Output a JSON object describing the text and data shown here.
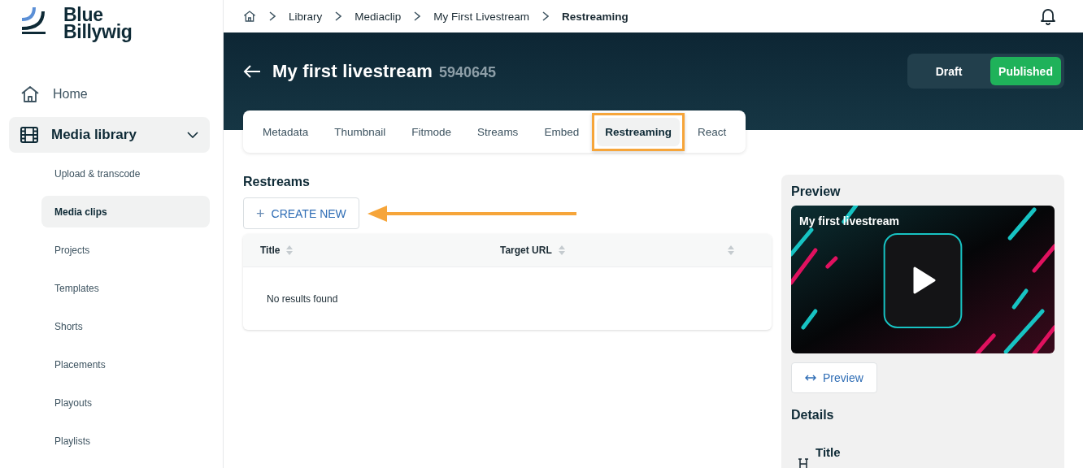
{
  "logo": {
    "lines": [
      "Blue",
      "Billywig"
    ]
  },
  "sidebar": {
    "items": [
      {
        "label": "Home",
        "selected": false
      },
      {
        "label": "Media library",
        "selected": true,
        "expanded": true,
        "children": [
          {
            "label": "Upload & transcode",
            "selected": false
          },
          {
            "label": "Media clips",
            "selected": true
          },
          {
            "label": "Projects",
            "selected": false
          },
          {
            "label": "Templates",
            "selected": false
          },
          {
            "label": "Shorts",
            "selected": false
          },
          {
            "label": "Placements",
            "selected": false
          },
          {
            "label": "Playouts",
            "selected": false
          },
          {
            "label": "Playlists",
            "selected": false
          }
        ]
      }
    ]
  },
  "breadcrumb": [
    "Library",
    "Mediaclip",
    "My First Livestream",
    "Restreaming"
  ],
  "header": {
    "title": "My first livestream",
    "id": "5940645",
    "status": [
      {
        "label": "Draft",
        "selected": false
      },
      {
        "label": "Published",
        "selected": true
      }
    ]
  },
  "tabs": [
    {
      "label": "Metadata",
      "selected": false,
      "highlighted": false
    },
    {
      "label": "Thumbnail",
      "selected": false,
      "highlighted": false
    },
    {
      "label": "Fitmode",
      "selected": false,
      "highlighted": false
    },
    {
      "label": "Streams",
      "selected": false,
      "highlighted": false
    },
    {
      "label": "Embed",
      "selected": false,
      "highlighted": false
    },
    {
      "label": "Restreaming",
      "selected": true,
      "highlighted": true
    },
    {
      "label": "React",
      "selected": false,
      "highlighted": false
    }
  ],
  "restreams": {
    "heading": "Restreams",
    "create_button": {
      "icon": "+",
      "label": "CREATE NEW",
      "annotated": true
    },
    "table": {
      "columns": [
        "Title",
        "Target URL"
      ],
      "unlabeled_sort_column": true,
      "empty_text": "No results found"
    }
  },
  "preview_panel": {
    "heading": "Preview",
    "video": {
      "kind": "picture",
      "title": "My first livestream"
    },
    "preview_button": "Preview",
    "details_heading": "Details",
    "detail_rows": [
      {
        "label": "Title"
      }
    ]
  }
}
